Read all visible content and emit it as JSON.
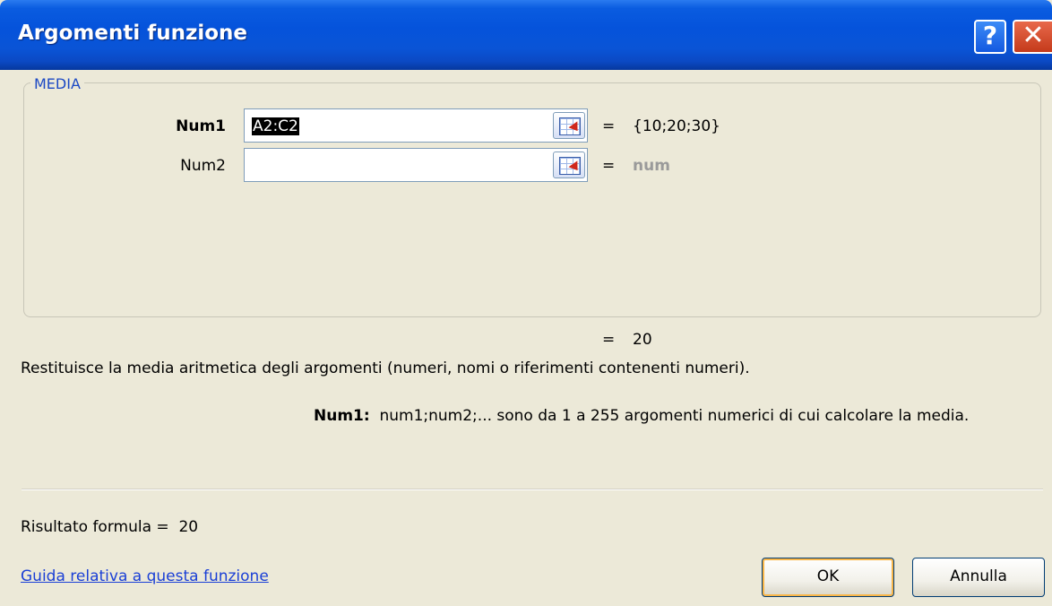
{
  "window": {
    "title": "Argomenti funzione",
    "help_button": "?",
    "close_button": "✕"
  },
  "group": {
    "label": "MEDIA"
  },
  "args": [
    {
      "label": "Num1",
      "value": "A2:C2",
      "selected": true,
      "equals": "=",
      "result": "{10;20;30}"
    },
    {
      "label": "Num2",
      "value": "",
      "selected": false,
      "equals": "=",
      "result": "num"
    }
  ],
  "function_result": {
    "equals": "=",
    "value": "20"
  },
  "description": "Restituisce la media aritmetica degli argomenti (numeri, nomi o riferimenti contenenti numeri).",
  "arg_help": {
    "name": "Num1:",
    "text": "num1;num2;... sono da 1 a 255 argomenti numerici di cui calcolare la media."
  },
  "formula_result": {
    "label": "Risultato formula =",
    "value": "20"
  },
  "help_link": "Guida relativa a questa funzione",
  "buttons": {
    "ok": "OK",
    "cancel": "Annulla"
  },
  "icons": {
    "range_picker": "range-picker-icon"
  }
}
